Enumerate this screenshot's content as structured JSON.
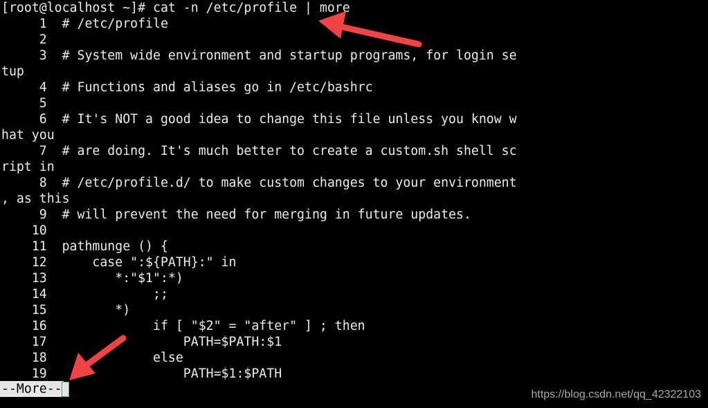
{
  "terminal": {
    "lines": [
      "[root@localhost ~]# cat -n /etc/profile | more",
      "     1  # /etc/profile",
      "     2",
      "     3  # System wide environment and startup programs, for login se",
      "tup",
      "     4  # Functions and aliases go in /etc/bashrc",
      "     5",
      "     6  # It's NOT a good idea to change this file unless you know w",
      "hat you",
      "     7  # are doing. It's much better to create a custom.sh shell sc",
      "ript in",
      "     8  # /etc/profile.d/ to make custom changes to your environment",
      ", as this",
      "     9  # will prevent the need for merging in future updates.",
      "    10",
      "    11  pathmunge () {",
      "    12      case \":${PATH}:\" in",
      "    13         *:\"$1\":*)",
      "    14              ;;",
      "    15         *)",
      "    16              if [ \"$2\" = \"after\" ] ; then",
      "    17                  PATH=$PATH:$1",
      "    18              else",
      "    19                  PATH=$1:$PATH"
    ],
    "more_prompt": "--More--"
  },
  "watermark": "https://blog.csdn.net/qq_42322103",
  "colors": {
    "background": "#000000",
    "text": "#ececec",
    "arrow": "#f04444",
    "cursor": "#19d219"
  }
}
